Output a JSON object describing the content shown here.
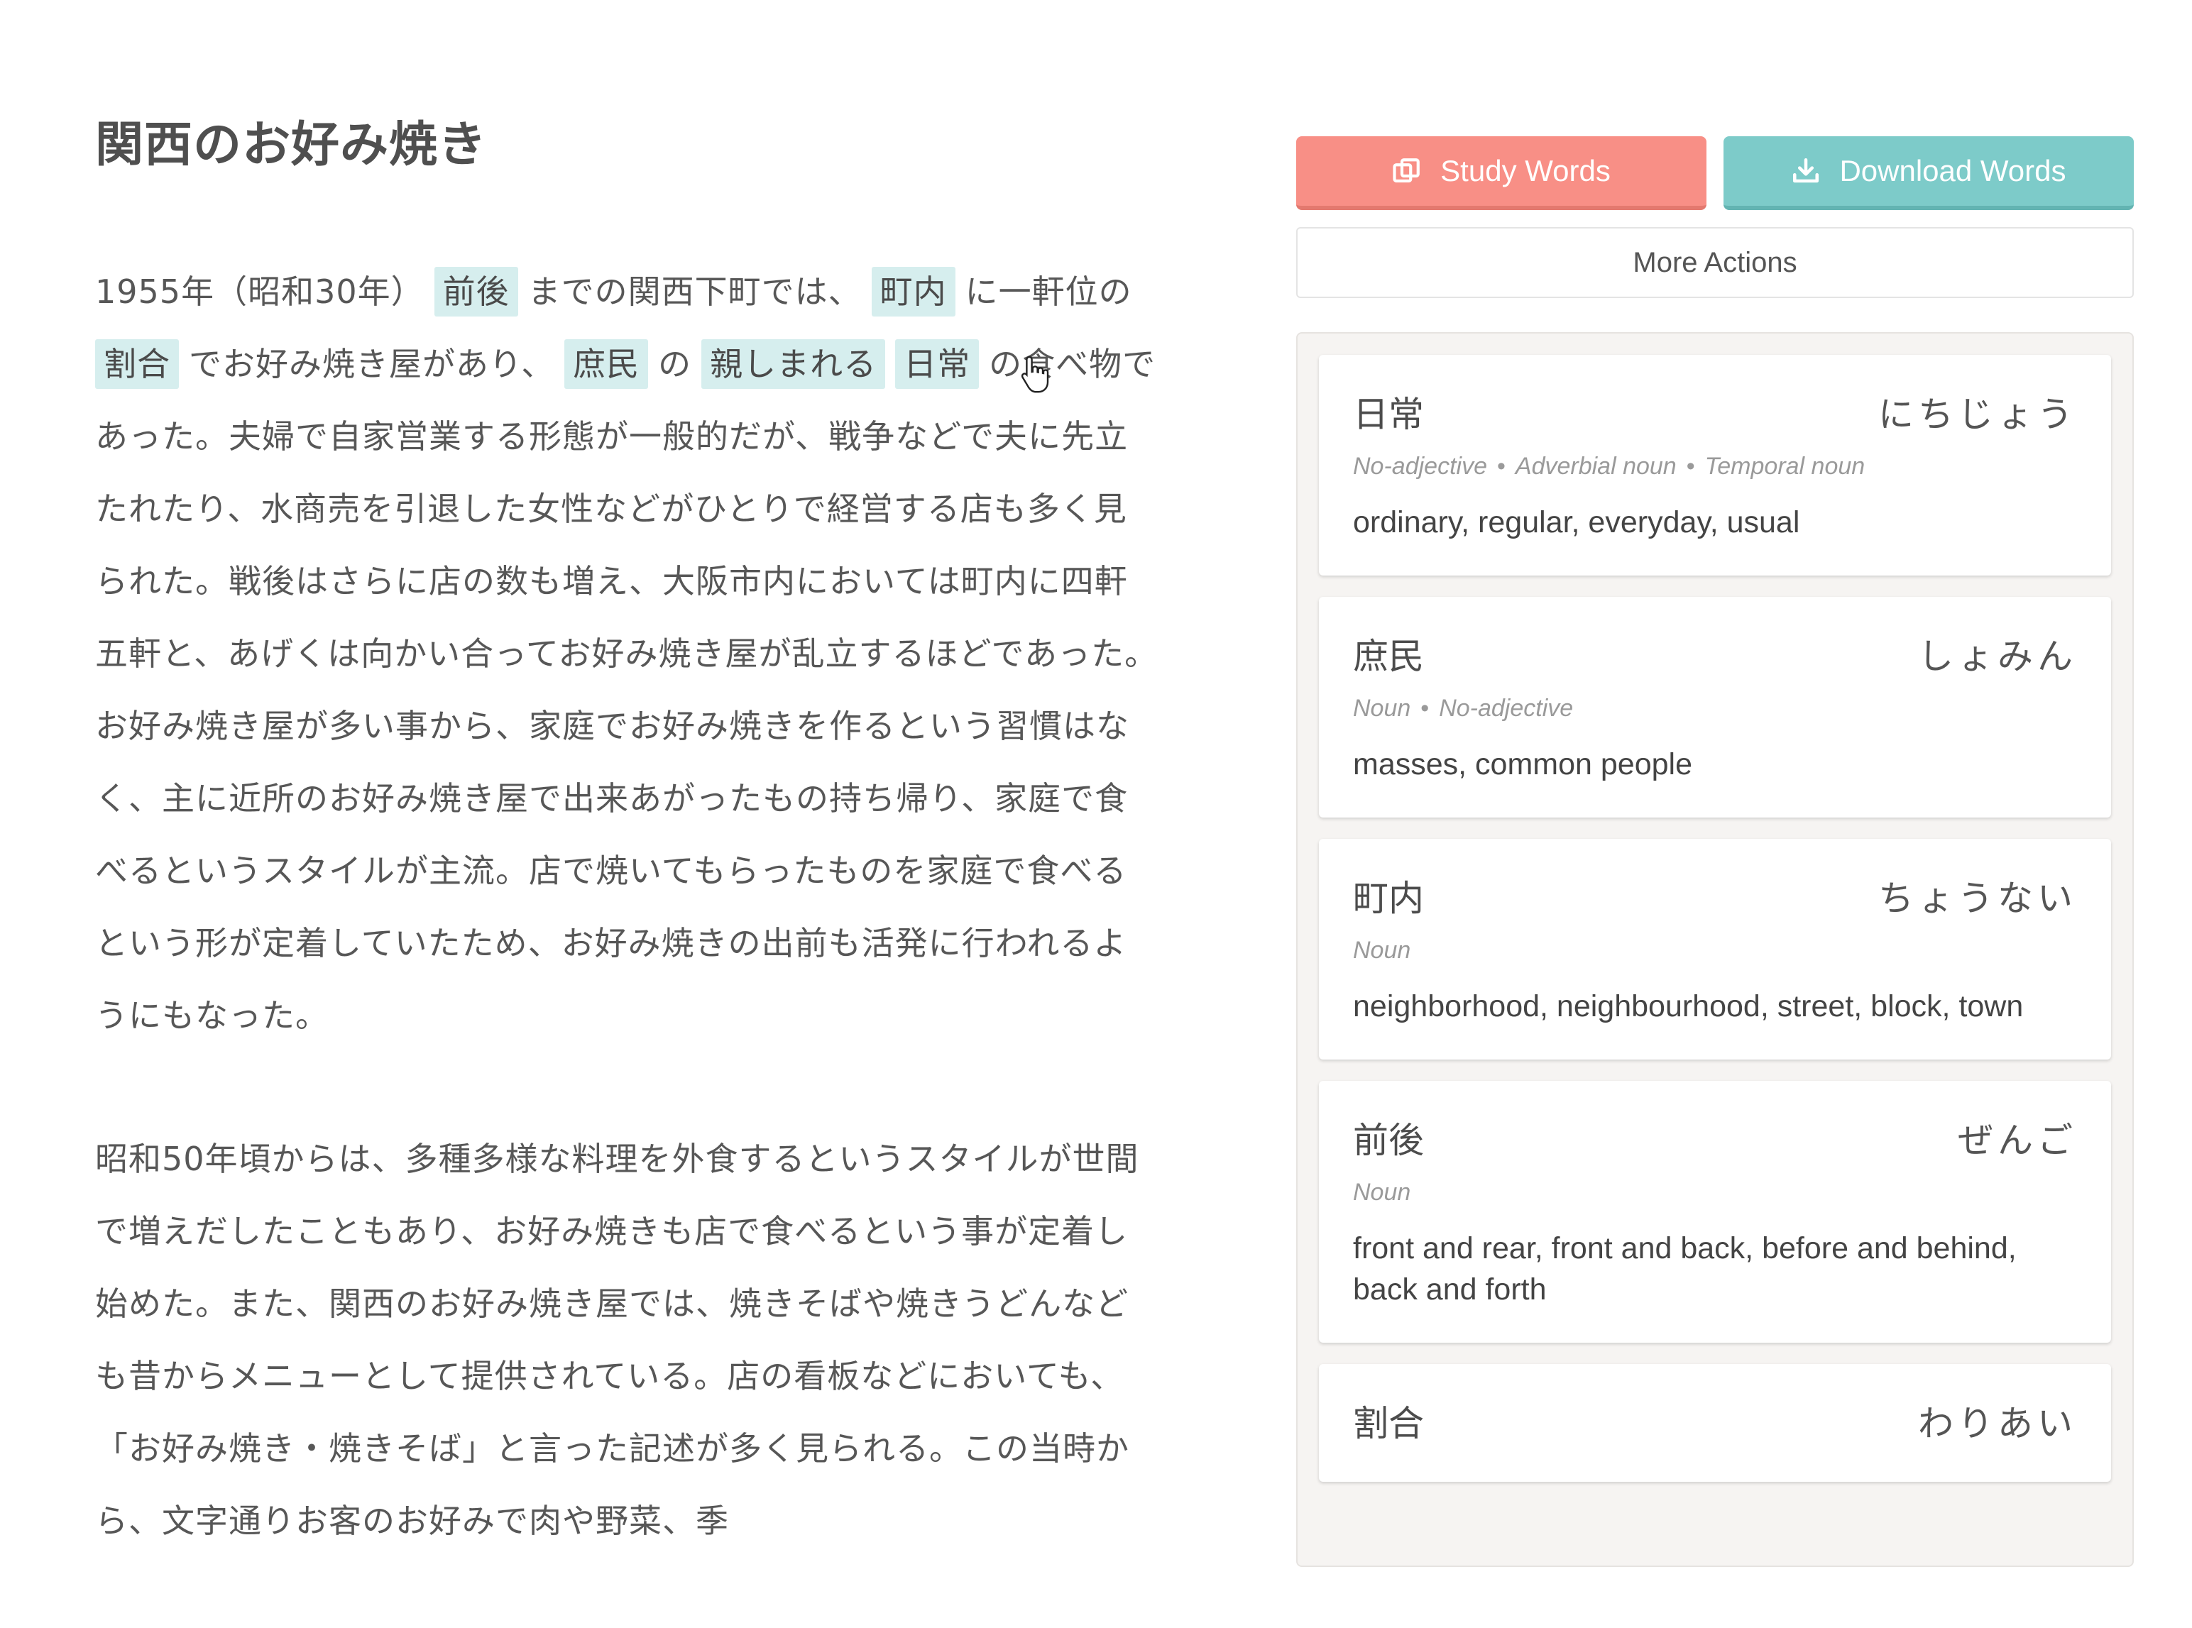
{
  "article": {
    "title": "関西のお好み焼き",
    "p1": {
      "t1": "1955年（昭和30年）",
      "h1": "前後",
      "t2": "までの関西下町では、",
      "h2": "町内",
      "t3": "に一軒位の",
      "h3": "割合",
      "t4": "でお好み焼き屋があり、",
      "h4": "庶民",
      "t5": "の",
      "h5": "親しまれる",
      "h6": "日常",
      "t6": "の食べ物であった。夫婦で自家営業する形態が一般的だが、戦争などで夫に先立たれたり、水商売を引退した女性などがひとりで経営する店も多く見られた。戦後はさらに店の数も増え、大阪市内においては町内に四軒五軒と、あげくは向かい合ってお好み焼き屋が乱立するほどであった。お好み焼き屋が多い事から、家庭でお好み焼きを作るという習慣はなく、主に近所のお好み焼き屋で出来あがったもの持ち帰り、家庭で食べるというスタイルが主流。店で焼いてもらったものを家庭で食べるという形が定着していたため、お好み焼きの出前も活発に行われるようにもなった。"
    },
    "p2": "昭和50年頃からは、多種多様な料理を外食するというスタイルが世間で増えだしたこともあり、お好み焼きも店で食べるという事が定着し始めた。また、関西のお好み焼き屋では、焼きそばや焼きうどんなども昔からメニューとして提供されている。店の看板などにおいても、「お好み焼き・焼きそば」と言った記述が多く見られる。この当時から、文字通りお客のお好みで肉や野菜、季"
  },
  "actions": {
    "study_label": "Study Words",
    "download_label": "Download Words",
    "more_label": "More Actions"
  },
  "words": [
    {
      "word": "日常",
      "reading": "にちじょう",
      "pos": [
        "No-adjective",
        "Adverbial noun",
        "Temporal noun"
      ],
      "definition": "ordinary, regular, everyday, usual"
    },
    {
      "word": "庶民",
      "reading": "しょみん",
      "pos": [
        "Noun",
        "No-adjective"
      ],
      "definition": "masses, common people"
    },
    {
      "word": "町内",
      "reading": "ちょうない",
      "pos": [
        "Noun"
      ],
      "definition": "neighborhood, neighbourhood, street, block, town"
    },
    {
      "word": "前後",
      "reading": "ぜんご",
      "pos": [
        "Noun"
      ],
      "definition": "front and rear, front and back, before and behind, back and forth"
    },
    {
      "word": "割合",
      "reading": "わりあい",
      "pos": [],
      "definition": ""
    }
  ],
  "colors": {
    "study_button": "#f88f86",
    "download_button": "#7dcbc9",
    "highlight": "#d6eeee",
    "panel_bg": "#f6f4f2"
  },
  "icons": {
    "study": "copy-cards-icon",
    "download": "download-icon",
    "cursor": "hand-pointer-icon"
  }
}
